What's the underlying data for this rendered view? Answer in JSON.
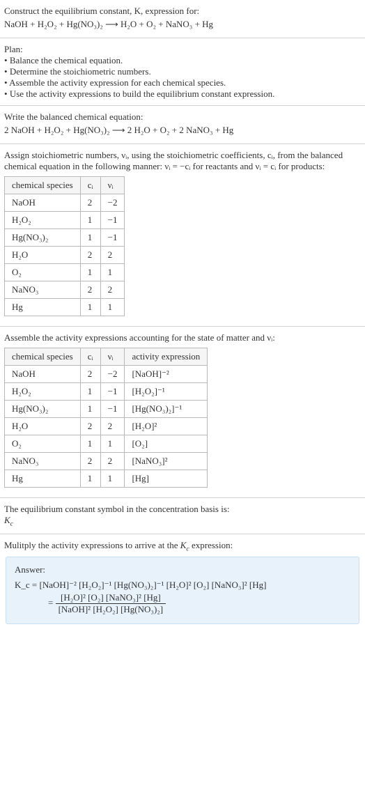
{
  "intro": {
    "line1": "Construct the equilibrium constant, K, expression for:",
    "equation": "NaOH + H₂O₂ + Hg(NO₃)₂  ⟶  H₂O + O₂ + NaNO₃ + Hg"
  },
  "plan": {
    "heading": "Plan:",
    "items": [
      "Balance the chemical equation.",
      "Determine the stoichiometric numbers.",
      "Assemble the activity expression for each chemical species.",
      "Use the activity expressions to build the equilibrium constant expression."
    ]
  },
  "balanced": {
    "heading": "Write the balanced chemical equation:",
    "equation": "2 NaOH + H₂O₂ + Hg(NO₃)₂  ⟶  2 H₂O + O₂ + 2 NaNO₃ + Hg"
  },
  "stoich_text": "Assign stoichiometric numbers, νᵢ, using the stoichiometric coefficients, cᵢ, from the balanced chemical equation in the following manner: νᵢ = −cᵢ for reactants and νᵢ = cᵢ for products:",
  "table1": {
    "headers": [
      "chemical species",
      "cᵢ",
      "νᵢ"
    ],
    "rows": [
      [
        "NaOH",
        "2",
        "−2"
      ],
      [
        "H₂O₂",
        "1",
        "−1"
      ],
      [
        "Hg(NO₃)₂",
        "1",
        "−1"
      ],
      [
        "H₂O",
        "2",
        "2"
      ],
      [
        "O₂",
        "1",
        "1"
      ],
      [
        "NaNO₃",
        "2",
        "2"
      ],
      [
        "Hg",
        "1",
        "1"
      ]
    ]
  },
  "assemble_text": "Assemble the activity expressions accounting for the state of matter and νᵢ:",
  "table2": {
    "headers": [
      "chemical species",
      "cᵢ",
      "νᵢ",
      "activity expression"
    ],
    "rows": [
      [
        "NaOH",
        "2",
        "−2",
        "[NaOH]⁻²"
      ],
      [
        "H₂O₂",
        "1",
        "−1",
        "[H₂O₂]⁻¹"
      ],
      [
        "Hg(NO₃)₂",
        "1",
        "−1",
        "[Hg(NO₃)₂]⁻¹"
      ],
      [
        "H₂O",
        "2",
        "2",
        "[H₂O]²"
      ],
      [
        "O₂",
        "1",
        "1",
        "[O₂]"
      ],
      [
        "NaNO₃",
        "2",
        "2",
        "[NaNO₃]²"
      ],
      [
        "Hg",
        "1",
        "1",
        "[Hg]"
      ]
    ]
  },
  "kc_symbol": {
    "line": "The equilibrium constant symbol in the concentration basis is:",
    "sym": "K_c"
  },
  "multiply_text": "Mulitply the activity expressions to arrive at the K_c expression:",
  "answer": {
    "label": "Answer:",
    "line1": "K_c = [NaOH]⁻² [H₂O₂]⁻¹ [Hg(NO₃)₂]⁻¹ [H₂O]² [O₂] [NaNO₃]² [Hg]",
    "frac_num": "[H₂O]² [O₂] [NaNO₃]² [Hg]",
    "frac_den": "[NaOH]² [H₂O₂] [Hg(NO₃)₂]",
    "eq_prefix": "= "
  },
  "chart_data": {
    "type": "table",
    "tables": [
      {
        "title": "stoichiometric numbers",
        "columns": [
          "chemical species",
          "c_i",
          "nu_i"
        ],
        "rows": [
          {
            "chemical species": "NaOH",
            "c_i": 2,
            "nu_i": -2
          },
          {
            "chemical species": "H2O2",
            "c_i": 1,
            "nu_i": -1
          },
          {
            "chemical species": "Hg(NO3)2",
            "c_i": 1,
            "nu_i": -1
          },
          {
            "chemical species": "H2O",
            "c_i": 2,
            "nu_i": 2
          },
          {
            "chemical species": "O2",
            "c_i": 1,
            "nu_i": 1
          },
          {
            "chemical species": "NaNO3",
            "c_i": 2,
            "nu_i": 2
          },
          {
            "chemical species": "Hg",
            "c_i": 1,
            "nu_i": 1
          }
        ]
      },
      {
        "title": "activity expressions",
        "columns": [
          "chemical species",
          "c_i",
          "nu_i",
          "activity expression"
        ],
        "rows": [
          {
            "chemical species": "NaOH",
            "c_i": 2,
            "nu_i": -2,
            "activity expression": "[NaOH]^-2"
          },
          {
            "chemical species": "H2O2",
            "c_i": 1,
            "nu_i": -1,
            "activity expression": "[H2O2]^-1"
          },
          {
            "chemical species": "Hg(NO3)2",
            "c_i": 1,
            "nu_i": -1,
            "activity expression": "[Hg(NO3)2]^-1"
          },
          {
            "chemical species": "H2O",
            "c_i": 2,
            "nu_i": 2,
            "activity expression": "[H2O]^2"
          },
          {
            "chemical species": "O2",
            "c_i": 1,
            "nu_i": 1,
            "activity expression": "[O2]"
          },
          {
            "chemical species": "NaNO3",
            "c_i": 2,
            "nu_i": 2,
            "activity expression": "[NaNO3]^2"
          },
          {
            "chemical species": "Hg",
            "c_i": 1,
            "nu_i": 1,
            "activity expression": "[Hg]"
          }
        ]
      }
    ]
  }
}
